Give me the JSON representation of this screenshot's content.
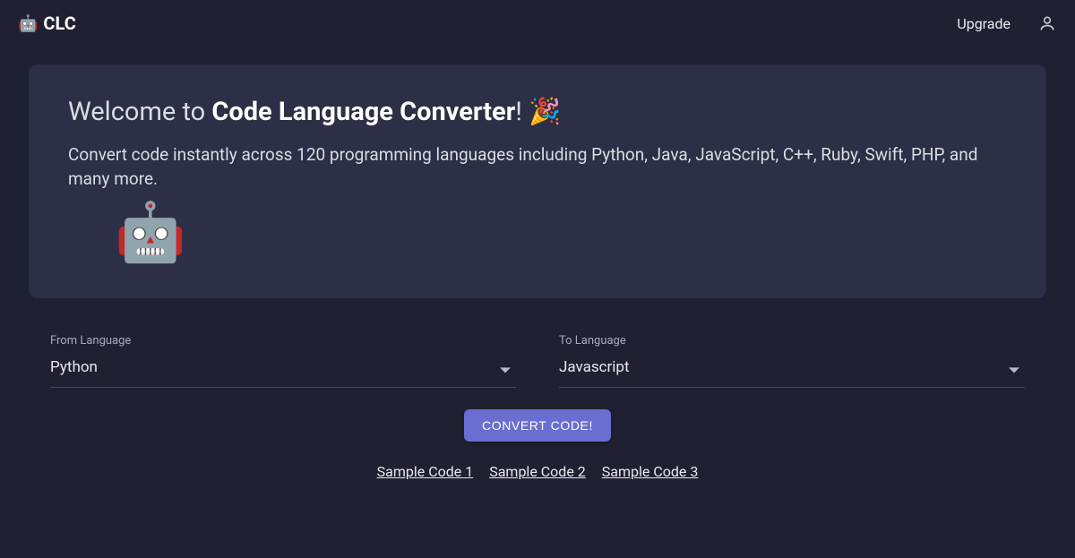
{
  "header": {
    "brand_emoji": "🤖",
    "brand_text": "CLC",
    "upgrade": "Upgrade"
  },
  "welcome": {
    "prefix": "Welcome to ",
    "strong": "Code Language Converter",
    "suffix": "! 🎉",
    "description": "Convert code instantly across 120 programming languages including Python, Java, JavaScript, C++, Ruby, Swift, PHP, and many more.",
    "robot": "🤖"
  },
  "from": {
    "label": "From Language",
    "value": "Python"
  },
  "to": {
    "label": "To Language",
    "value": "Javascript"
  },
  "convert": {
    "button": "CONVERT CODE!"
  },
  "samples": {
    "link1": "Sample Code 1",
    "link2": "Sample Code 2",
    "link3": "Sample Code 3"
  }
}
